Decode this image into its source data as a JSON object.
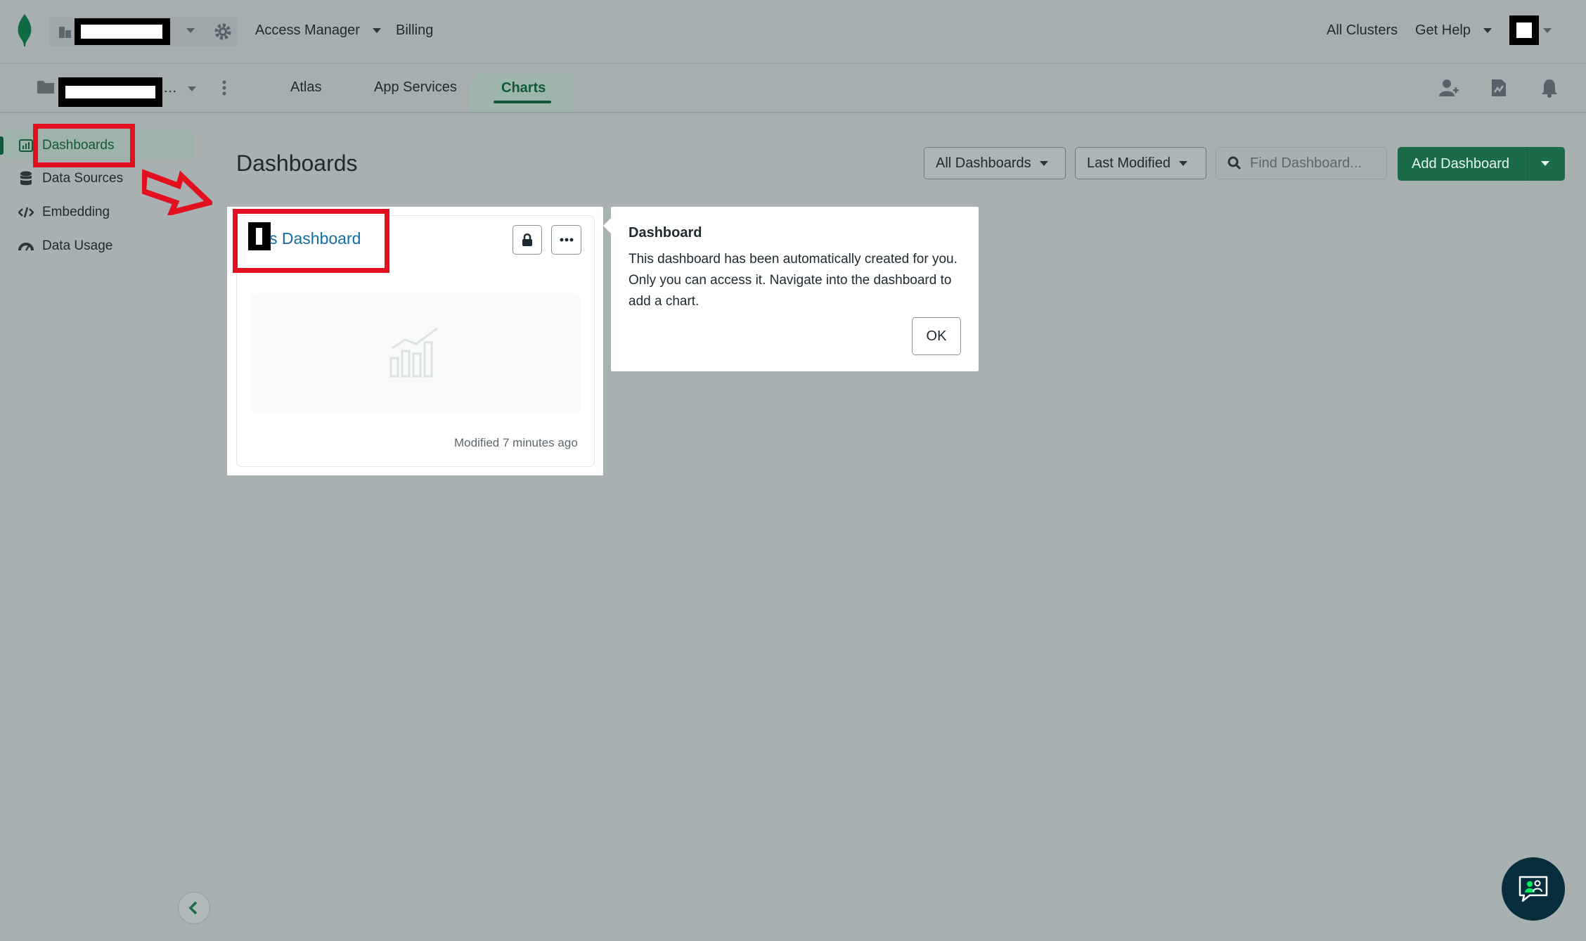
{
  "topbar": {
    "access_manager": "Access Manager",
    "billing": "Billing",
    "all_clusters": "All Clusters",
    "get_help": "Get Help"
  },
  "subbar": {
    "project_suffix": "…",
    "tabs": [
      {
        "label": "Atlas"
      },
      {
        "label": "App Services"
      },
      {
        "label": "Charts"
      }
    ]
  },
  "sidebar": {
    "items": [
      {
        "label": "Dashboards"
      },
      {
        "label": "Data Sources"
      },
      {
        "label": "Embedding"
      },
      {
        "label": "Data Usage"
      }
    ]
  },
  "main": {
    "title": "Dashboards",
    "filter_all": "All Dashboards",
    "sort": "Last Modified",
    "search_placeholder": "Find Dashboard...",
    "add_button": "Add Dashboard"
  },
  "card": {
    "title_prefix": "s",
    "title": "Dashboard",
    "modified": "Modified 7 minutes ago"
  },
  "tooltip": {
    "title": "Dashboard",
    "body": "This dashboard has been automatically created for you. Only you can access it. Navigate into the dashboard to add a chart.",
    "ok": "OK"
  },
  "colors": {
    "accent_green": "#1a6b47",
    "link_blue": "#126ea2",
    "annotation_red": "#e3101f"
  }
}
